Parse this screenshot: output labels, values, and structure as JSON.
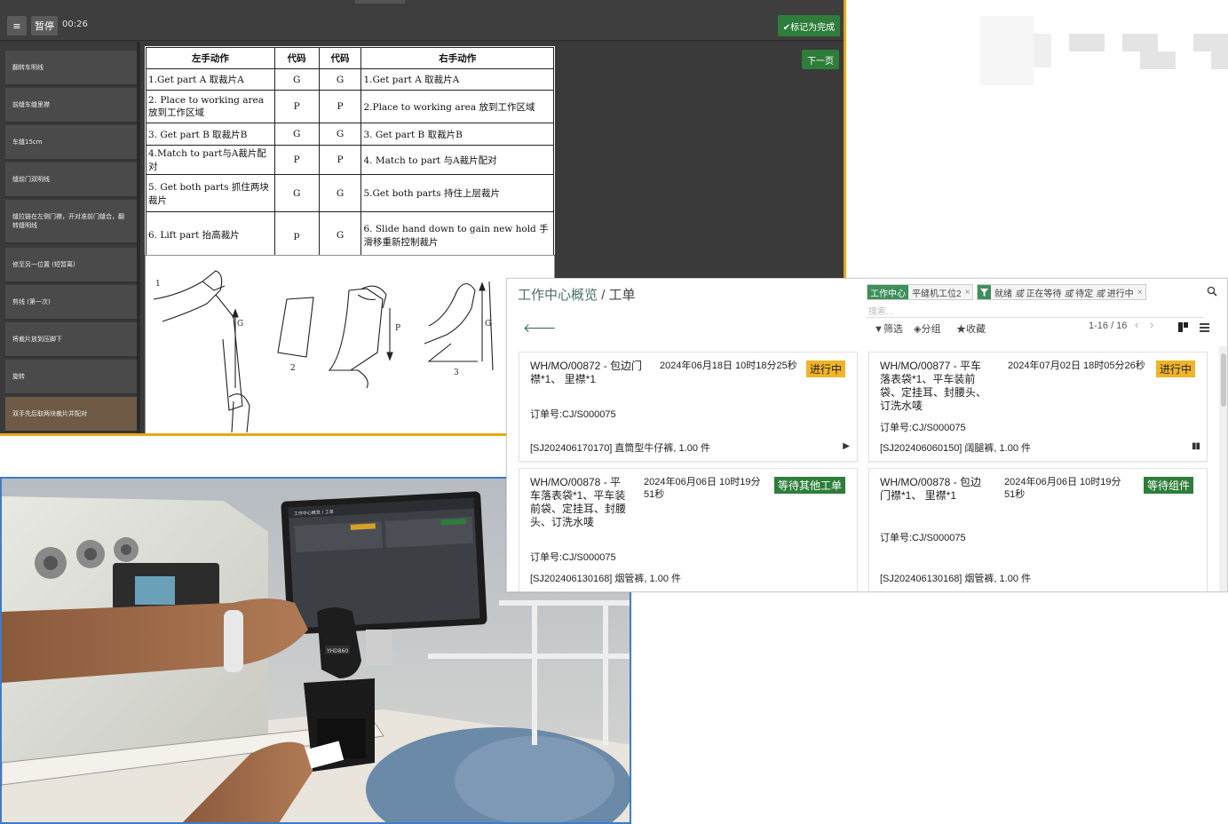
{
  "work_instruction": {
    "menu_icon": "≡",
    "pause_label": "暂停",
    "timer": "00:26",
    "complete_label": "✔标记为完成",
    "next_label": "下一页",
    "steps": [
      "翻转车明线",
      "前缝车缝里襟",
      "车缝15cm",
      "缝前门双明线",
      "缝拉链在左侧门襟，开对准前门缝合，翻转缝明线",
      "修至另一位置 (短暂离)",
      "剪线 (第一次)",
      "将裁片放到压脚下",
      "旋转",
      "双手先后取两块裁片并配对"
    ],
    "table": {
      "headers": [
        "左手动作",
        "代码",
        "代码",
        "右手动作"
      ],
      "rows": [
        {
          "left": "1.Get part A 取裁片A",
          "lc": "G",
          "rc": "G",
          "right": "1.Get part A 取裁片A"
        },
        {
          "left": "2. Place to working area 放到工作区域",
          "lc": "P",
          "rc": "P",
          "right": "2.Place to working area 放到工作区域"
        },
        {
          "left": "3. Get part B 取裁片B",
          "lc": "G",
          "rc": "G",
          "right": "3. Get part B 取裁片B"
        },
        {
          "left": "4.Match to part与A裁片配对",
          "lc": "P",
          "rc": "P",
          "right": "4. Match to part 与A裁片配对"
        },
        {
          "left": "5. Get both parts 抓住两块裁片",
          "lc": "G",
          "rc": "G",
          "right": "5.Get both parts 持住上层裁片"
        },
        {
          "left": "6. Lift part 抬高裁片",
          "lc": "p",
          "rc": "G",
          "right": "6. Slide hand down to gain new hold 手滑移重新控制裁片"
        }
      ]
    },
    "drawing_labels": [
      "1",
      "G",
      "2",
      "P",
      "3",
      "G"
    ]
  },
  "work_center": {
    "breadcrumb_parent": "工作中心概览",
    "breadcrumb_sep": "/",
    "breadcrumb_current": "工单",
    "facet1_tag": "工作中心",
    "facet1_value": "平缝机工位2",
    "facet2_value_parts": [
      "就绪",
      "或",
      "正在等待",
      "或",
      "待定",
      "或",
      "进行中"
    ],
    "facet_close": "×",
    "search_placeholder": "搜索...",
    "filter_label": "筛选",
    "group_label": "分组",
    "favorite_label": "收藏",
    "pager": "1-16 / 16",
    "cards": [
      {
        "ref": "WH/MO/00872 - 包边门襟*1、 里襟*1",
        "date": "2024年06月18日 10时18分25秒",
        "state": "进行中",
        "order": "订单号:CJ/S000075",
        "product": "[SJ202406170170] 直筒型牛仔裤, 1.00 件",
        "control": "▶"
      },
      {
        "ref": "WH/MO/00877 - 平车落表袋*1、平车装前袋、定挂耳、封腰头、订洗水唛",
        "date": "2024年07月02日 18时05分26秒",
        "state": "进行中",
        "order": "订单号:CJ/S000075",
        "product": "[SJ202406060150] 阔腿裤, 1.00 件",
        "control": "▮▮"
      },
      {
        "ref": "WH/MO/00878 - 平车落表袋*1、平车装前袋、定挂耳、封腰头、订洗水唛",
        "date": "2024年06月06日 10时19分51秒",
        "state": "等待其他工单",
        "order": "订单号:CJ/S000075",
        "product": "[SJ202406130168] 烟管裤, 1.00 件",
        "control": ""
      },
      {
        "ref": "WH/MO/00878 - 包边门襟*1、 里襟*1",
        "date": "2024年06月06日 10时19分51秒",
        "state": "等待组件",
        "order": "订单号:CJ/S000075",
        "product": "[SJ202406130168] 烟管裤, 1.00 件",
        "control": ""
      }
    ]
  },
  "photo": {
    "scanner_brand": "YHD860",
    "tablet_title": "工作中心概览 / 工单"
  },
  "colors": {
    "accent_orange": "#e6a817",
    "success_green": "#2e7d3a",
    "frame_blue": "#3d7cc9"
  }
}
